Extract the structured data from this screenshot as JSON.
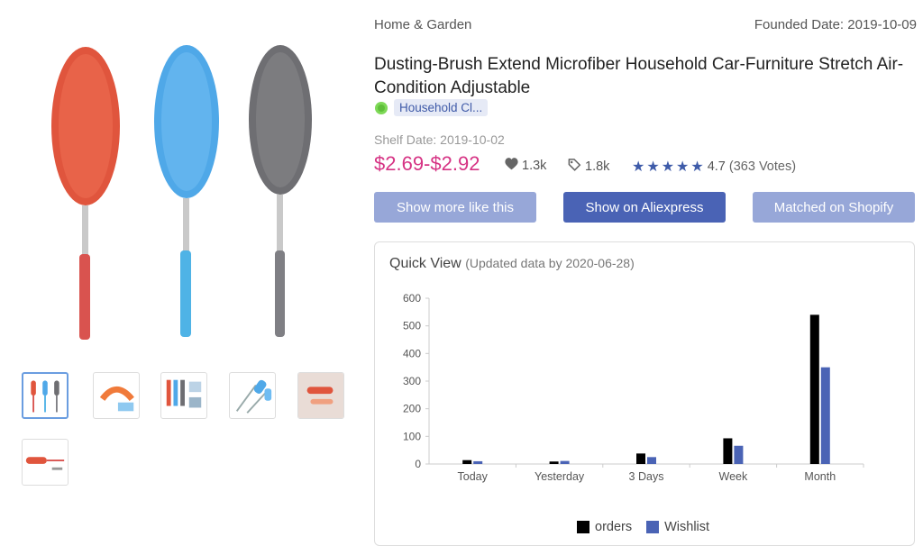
{
  "gallery": {
    "main_image": "dusting brushes red blue gray",
    "thumbnails": [
      "duster-set",
      "duster-bent",
      "duster-four",
      "duster-blue",
      "duster-kit",
      "duster-red"
    ]
  },
  "header": {
    "category": "Home & Garden",
    "founded_date": "Founded Date: 2019-10-09"
  },
  "product": {
    "title": "Dusting-Brush Extend Microfiber Household Car-Furniture Stretch Air-Condition Adjustable",
    "store_tag": "Household Cl...",
    "shelf_date": "Shelf Date: 2019-10-02",
    "price": "$2.69-$2.92",
    "likes": "1.3k",
    "tags": "1.8k",
    "rating": "4.7",
    "votes": "(363 Votes)"
  },
  "buttons": {
    "more_like_this": "Show more like this",
    "aliexpress": "Show on Aliexpress",
    "shopify": "Matched on Shopify"
  },
  "quick_view": {
    "title": "Quick View",
    "subtitle": "(Updated data by 2020-06-28)"
  },
  "colors": {
    "orders": "#000000",
    "wishlist": "#4a63b5",
    "price": "#d63384"
  },
  "chart_data": {
    "type": "bar",
    "categories": [
      "Today",
      "Yesterday",
      "3 Days",
      "Week",
      "Month"
    ],
    "series": [
      {
        "name": "orders",
        "values": [
          14,
          9,
          38,
          93,
          540
        ]
      },
      {
        "name": "Wishlist",
        "values": [
          10,
          11,
          25,
          66,
          350
        ]
      }
    ],
    "ylim": [
      0,
      600
    ],
    "yticks": [
      0,
      100,
      200,
      300,
      400,
      500,
      600
    ],
    "legend_position": "bottom-center",
    "grid": false
  }
}
